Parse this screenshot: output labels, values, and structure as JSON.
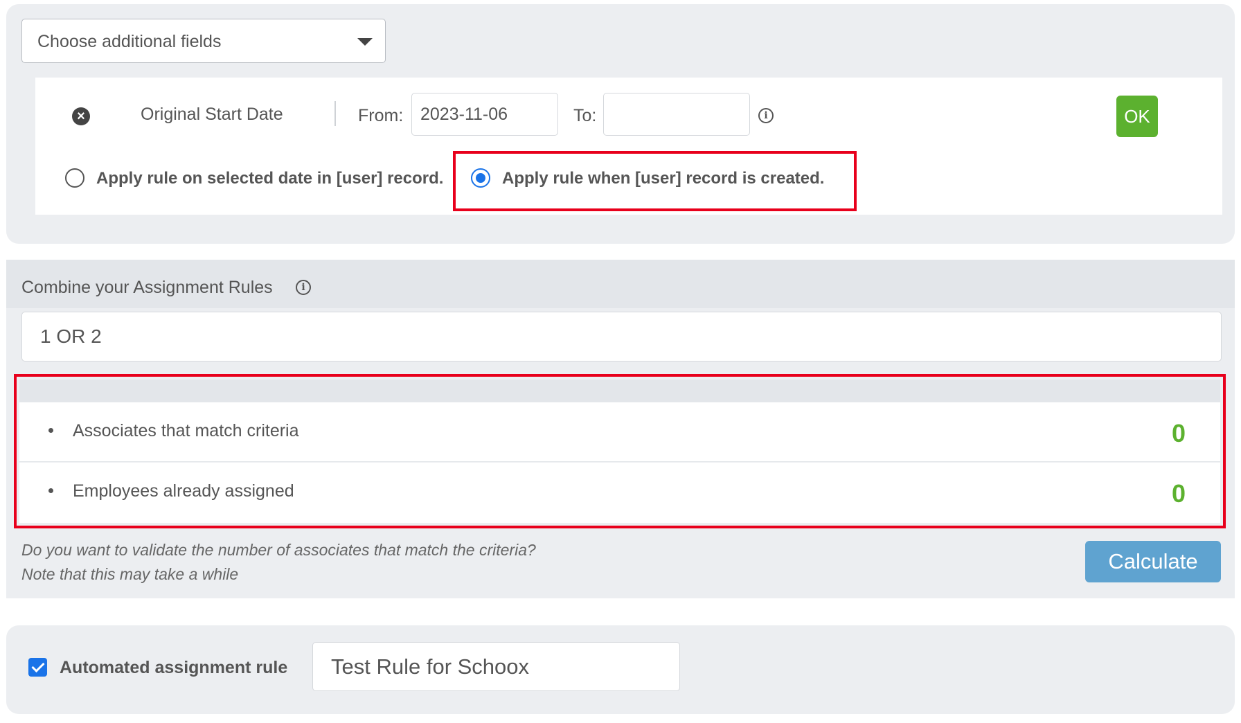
{
  "additional_fields": {
    "dropdown_label": "Choose additional fields"
  },
  "rule": {
    "field_name": "Original Start Date",
    "from_label": "From:",
    "from_value": "2023-11-06",
    "to_label": "To:",
    "to_value": "",
    "info_icon": "info-icon",
    "ok_label": "OK",
    "apply_options": [
      {
        "label": "Apply rule on selected date in [user] record.",
        "checked": false
      },
      {
        "label": "Apply rule when [user] record is created.",
        "checked": true
      }
    ]
  },
  "combine": {
    "label": "Combine your Assignment Rules",
    "value": "1 OR 2"
  },
  "stats": [
    {
      "label": "Associates that match criteria",
      "value": "0"
    },
    {
      "label": "Employees already assigned",
      "value": "0"
    }
  ],
  "validate": {
    "note_line1": "Do you want to validate the number of associates that match the criteria?",
    "note_line2": "Note that this may take a while",
    "button_label": "Calculate"
  },
  "automation": {
    "checkbox_label": "Automated assignment rule",
    "checked": true,
    "rule_name": "Test Rule for Schoox"
  },
  "colors": {
    "ok_green": "#5cb12f",
    "value_green": "#5cb12f",
    "calculate_blue": "#5fa3d0",
    "highlight_red": "#e8001c",
    "radio_blue": "#1a73e8"
  }
}
